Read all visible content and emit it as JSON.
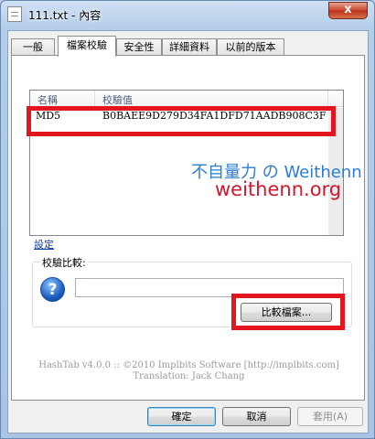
{
  "window": {
    "title": "111.txt - 內容",
    "close_label": "x"
  },
  "tabs": [
    {
      "label": "一般",
      "active": false
    },
    {
      "label": "檔案校驗",
      "active": true
    },
    {
      "label": "安全性",
      "active": false
    },
    {
      "label": "詳細資料",
      "active": false
    },
    {
      "label": "以前的版本",
      "active": false
    }
  ],
  "hash_list": {
    "columns": [
      "名稱",
      "校驗值"
    ],
    "rows": [
      {
        "name": "MD5",
        "value": "B0BAEE9D279D34FA1DFD71AADB908C3F"
      }
    ]
  },
  "watermark": {
    "line1": "不自量力 の Weithenn",
    "line2": "weithenn.org"
  },
  "settings_link": "設定",
  "compare": {
    "group_title": "校驗比較:",
    "input_value": "",
    "button_label": "比較檔案..."
  },
  "credits": {
    "line1": "HashTab v4.0.0 :: ©2010 Implbits Software [http://implbits.com]",
    "line2": "Translation: Jack Chang"
  },
  "buttons": {
    "ok": "確定",
    "cancel": "取消",
    "apply": "套用(A)"
  },
  "colors": {
    "highlight": "#e3151e",
    "watermark_blue": "#2a7ed2",
    "watermark_red": "#d6162a"
  }
}
